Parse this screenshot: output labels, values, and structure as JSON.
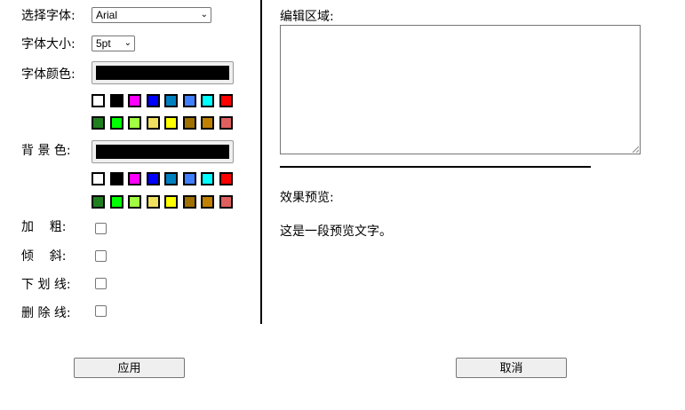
{
  "font_label": "选择字体:",
  "font_value": "Arial",
  "size_label": "字体大小:",
  "size_value": "5pt",
  "color_label": "字体颜色:",
  "color_value": "#000000",
  "bg_label": "背 景 色:",
  "bg_value": "#000000",
  "palette": [
    "#ffffff",
    "#000000",
    "#ff00ff",
    "#0000ff",
    "#0080c0",
    "#4080ff",
    "#00ffff",
    "#ff0000",
    "#208020",
    "#00ff00",
    "#a0ff40",
    "#f0e060",
    "#ffff00",
    "#a07000",
    "#c08000",
    "#e06060"
  ],
  "bold_label": "加    粗:",
  "italic_label": "倾    斜:",
  "underline_label": "下 划 线:",
  "strike_label": "删 除 线:",
  "edit_label": "编辑区域:",
  "textarea_value": "",
  "preview_label": "效果预览:",
  "preview_text": "这是一段预览文字。",
  "apply_label": "应用",
  "cancel_label": "取消"
}
